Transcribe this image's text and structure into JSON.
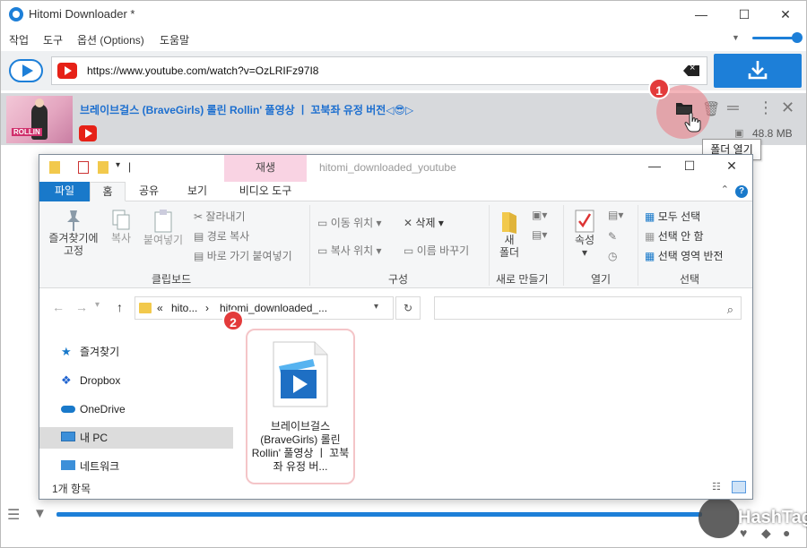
{
  "app": {
    "title": "Hitomi Downloader *",
    "menu": [
      "작업",
      "도구",
      "옵션 (Options)",
      "도움말"
    ],
    "url": "https://www.youtube.com/watch?v=OzLRIFz97I8",
    "task": {
      "title": "브레이브걸스 (BraveGirls) 롤린 Rollin' 풀영상 ㅣ 꼬북좌 유정 버전◁😎▷",
      "size": "48.8 MB",
      "thumb_label": "ROLLIN"
    },
    "tooltip": "폴더 열기",
    "badges": [
      "1",
      "2"
    ],
    "colors": {
      "accent": "#1d7fd8",
      "youtube": "#e62117",
      "highlight": "#eb7882"
    },
    "watermark": "HashTag"
  },
  "explorer": {
    "video_tools_tab": "재생",
    "title": "hitomi_downloaded_youtube",
    "tabs": [
      "파일",
      "홈",
      "공유",
      "보기",
      "비디오 도구"
    ],
    "ribbon": {
      "clipboard": {
        "pin": "즐겨찾기에\n고정",
        "copy": "복사",
        "paste": "붙여넣기",
        "cut": "잘라내기",
        "copy_path": "경로 복사",
        "paste_shortcut": "바로 가기 붙여넣기",
        "label": "클립보드"
      },
      "organize": {
        "move_to": "이동 위치",
        "copy_to": "복사 위치",
        "delete": "삭제",
        "rename": "이름 바꾸기",
        "label": "구성"
      },
      "new": {
        "new_folder": "새\n폴더",
        "label": "새로 만들기"
      },
      "open": {
        "properties": "속성",
        "label": "열기"
      },
      "select": {
        "select_all": "모두 선택",
        "select_none": "선택 안 함",
        "invert": "선택 영역 반전",
        "label": "선택"
      }
    },
    "address": {
      "prefix": "«",
      "crumb1": "hito...",
      "sep": "›",
      "crumb2": "hitomi_downloaded_..."
    },
    "nav": [
      "즐겨찾기",
      "Dropbox",
      "OneDrive",
      "내 PC",
      "네트워크"
    ],
    "file": {
      "name": "브레이브걸스 (BraveGirls) 롤린 Rollin' 풀영상 ㅣ 꼬북좌 유정 버..."
    },
    "status": "1개 항목"
  }
}
